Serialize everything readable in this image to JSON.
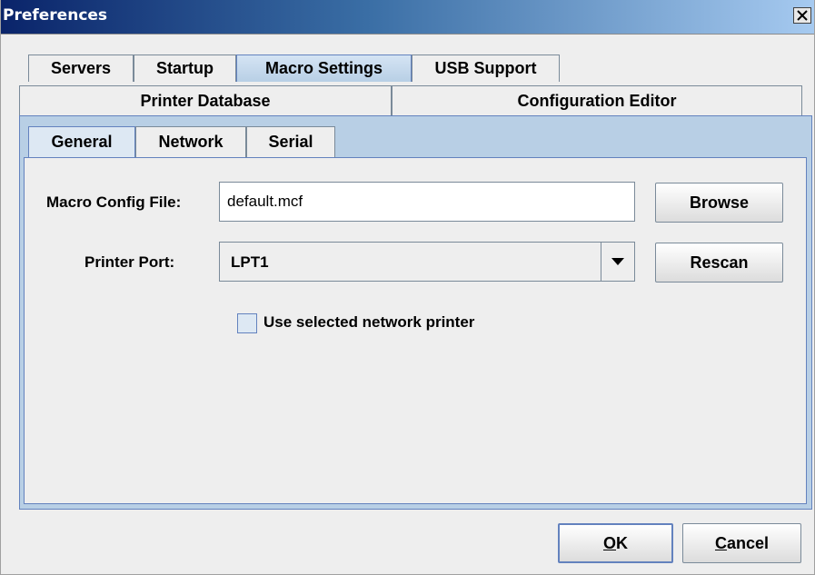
{
  "window": {
    "title": "Preferences",
    "close_glyph": "✕"
  },
  "outer_tabs": {
    "row1": [
      {
        "label": "Servers",
        "selected": false
      },
      {
        "label": "Startup",
        "selected": false
      },
      {
        "label": "Macro Settings",
        "selected": true
      },
      {
        "label": "USB Support",
        "selected": false
      }
    ],
    "row2": [
      {
        "label": "Printer Database"
      },
      {
        "label": "Configuration Editor"
      }
    ]
  },
  "inner_tabs": [
    {
      "label": "General",
      "selected": true
    },
    {
      "label": "Network",
      "selected": false
    },
    {
      "label": "Serial",
      "selected": false
    }
  ],
  "form": {
    "macro_config_label": "Macro Config File:",
    "macro_config_value": "default.mcf",
    "browse_label": "Browse",
    "printer_port_label": "Printer Port:",
    "printer_port_value": "LPT1",
    "rescan_label": "Rescan",
    "use_network_printer_label": "Use selected network printer",
    "use_network_printer_checked": false
  },
  "footer": {
    "ok_mnemonic": "O",
    "ok_rest": "K",
    "cancel_mnemonic": "C",
    "cancel_rest": "ancel"
  },
  "colors": {
    "accent": "#6382be",
    "selected_tab": "#b8cfe5",
    "window_bg": "#eeeeee"
  }
}
